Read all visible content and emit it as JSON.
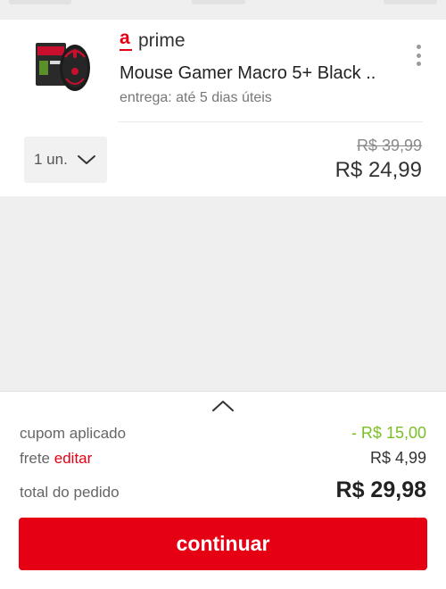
{
  "product": {
    "brand": "prime",
    "title": "Mouse Gamer Macro 5+ Black ..",
    "delivery": "entrega: até 5 dias úteis",
    "quantity_label": "1 un.",
    "old_price": "R$ 39,99",
    "price": "R$ 24,99"
  },
  "summary": {
    "coupon_label": "cupom aplicado",
    "coupon_value": "- R$ 15,00",
    "shipping_label": "frete",
    "shipping_edit": "editar",
    "shipping_value": "R$ 4,99",
    "total_label": "total do pedido",
    "total_value": "R$ 29,98"
  },
  "actions": {
    "continue_label": "continuar"
  },
  "icons": {
    "brand_logo": "americanas-logo-icon",
    "menu": "kebab-menu-icon",
    "quantity": "chevron-down-icon",
    "collapse": "chevron-up-icon"
  },
  "colors": {
    "accent": "#e60014",
    "discount": "#7bbf24",
    "background": "#efefef"
  }
}
